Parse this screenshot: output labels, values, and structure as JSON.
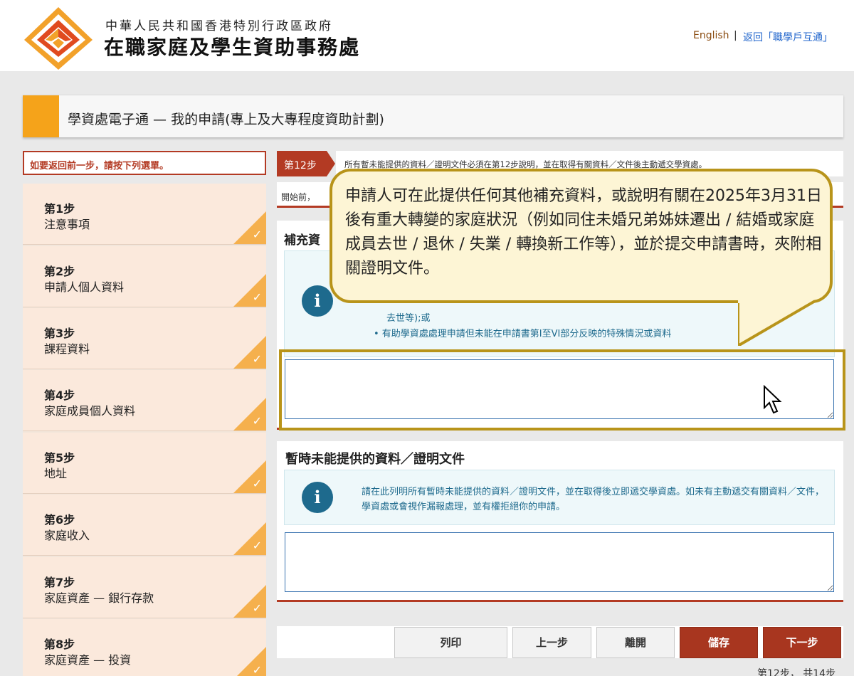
{
  "header": {
    "gov_name": "中華人民共和國香港特別行政區政府",
    "agency_name": "在職家庭及學生資助事務處",
    "lang_link": "English",
    "separator": "|",
    "back_link": "返回「職學戶互通」",
    "logo_icon": "wfsfaa-logo-icon"
  },
  "page_title": "學資處電子通 — 我的申請(專上及大專程度資助計劃)",
  "sidebar": {
    "back_hint": "如要返回前一步，請按下列選單。",
    "steps": [
      {
        "num": "第1步",
        "label": "注意事項"
      },
      {
        "num": "第2步",
        "label": "申請人個人資料"
      },
      {
        "num": "第3步",
        "label": "課程資料"
      },
      {
        "num": "第4步",
        "label": "家庭成員個人資料"
      },
      {
        "num": "第5步",
        "label": "地址"
      },
      {
        "num": "第6步",
        "label": "家庭收入"
      },
      {
        "num": "第7步",
        "label": "家庭資產 — 銀行存款"
      },
      {
        "num": "第8步",
        "label": "家庭資產 — 投資"
      }
    ],
    "check_icon": "check-icon"
  },
  "main": {
    "step_tag": "第12步",
    "step_notice": "所有暫未能提供的資料／證明文件必須在第12步說明，並在取得有關資料／文件後主動遞交學資處。",
    "start_line": "開始前，",
    "section1": {
      "title": "補充資",
      "bullet_fragment": "去世等);或",
      "bullet_item": "• 有助學資處處理申請但未能在申請書第I至VI部分反映的特殊情況或資料",
      "textarea_value": ""
    },
    "section2": {
      "title": "暫時未能提供的資料／證明文件",
      "info_text": "請在此列明所有暫時未能提供的資料／證明文件，並在取得後立即遞交學資處。如未有主動遞交有關資料／文件，學資處或會視作漏報處理，並有權拒絕你的申請。",
      "textarea_value": ""
    }
  },
  "buttons": {
    "print": "列印",
    "prev": "上一步",
    "exit": "離開",
    "save": "儲存",
    "next": "下一步"
  },
  "step_count": "第12步， 共14步",
  "callout": {
    "text": "申請人可在此提供任何其他補充資料，或說明有關在2025年3月31日後有重大轉變的家庭狀況（例如同住未婚兄弟姊妹遷出 / 結婚或家庭成員去世 / 退休 / 失業 / 轉換新工作等），並於提交申請書時，夾附相關證明文件。"
  },
  "colors": {
    "brand_red": "#b33a23",
    "accent_orange": "#f5a31a",
    "callout_border": "#b8941a",
    "info_blue": "#1e6a8d"
  }
}
